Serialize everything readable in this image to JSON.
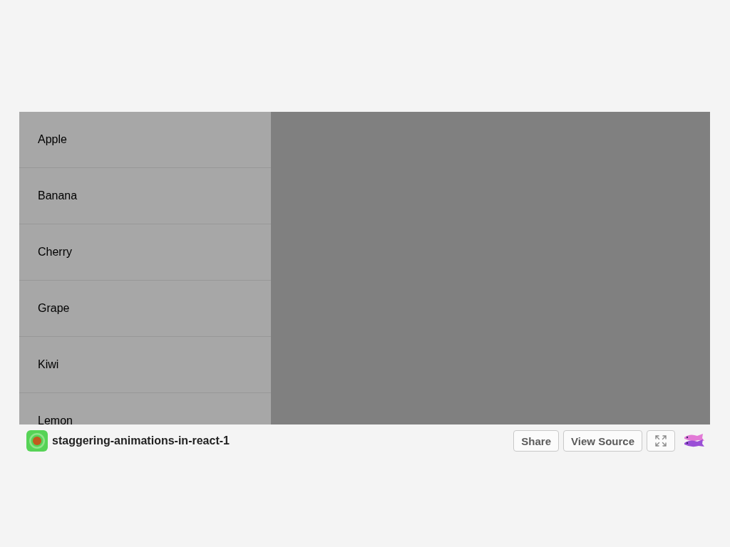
{
  "list": {
    "items": [
      {
        "label": "Apple"
      },
      {
        "label": "Banana"
      },
      {
        "label": "Cherry"
      },
      {
        "label": "Grape"
      },
      {
        "label": "Kiwi"
      },
      {
        "label": "Lemon"
      }
    ]
  },
  "footer": {
    "title": "staggering-animations-in-react-1",
    "buttons": [
      "Share",
      "View Source"
    ]
  }
}
